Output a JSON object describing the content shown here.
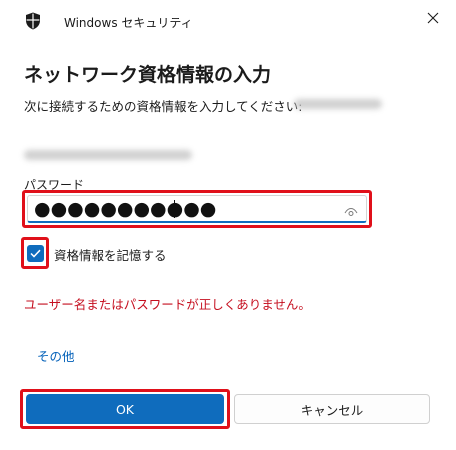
{
  "window": {
    "app_title": "Windows セキュリティ",
    "icon": "shield-icon",
    "close_icon": "close-icon"
  },
  "dialog": {
    "heading": "ネットワーク資格情報の入力",
    "instruction": "次に接続するための資格情報を入力してください:",
    "password": {
      "label": "パスワード",
      "masked_value": "●●●●●●●●●●●",
      "reveal_icon": "eye-icon"
    },
    "remember": {
      "label": "資格情報を記憶する",
      "checked": true
    },
    "error": "ユーザー名またはパスワードが正しくありません。",
    "more_link": "その他",
    "buttons": {
      "ok": "OK",
      "cancel": "キャンセル"
    }
  },
  "colors": {
    "accent": "#0f6cbd",
    "error": "#c50f1f",
    "highlight": "#e0101a",
    "link": "#005fb8"
  }
}
